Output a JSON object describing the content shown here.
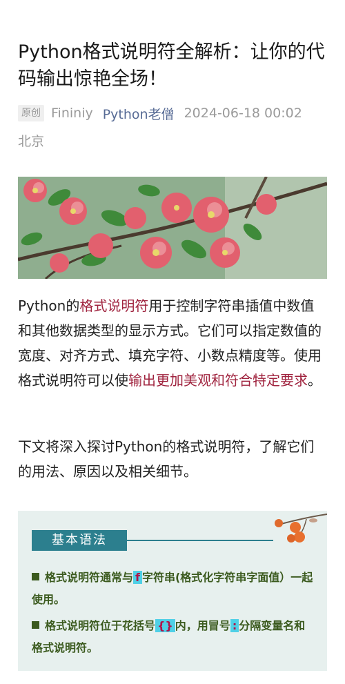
{
  "article": {
    "title": "Python格式说明符全解析：让你的代码输出惊艳全场！",
    "badge": "原创",
    "author": "Fininiy",
    "account": "Python老僧",
    "date": "2024-06-18 00:02",
    "location": "北京"
  },
  "hero_image": {
    "subject": "pink quince blossoms on a branch"
  },
  "paragraph1": {
    "a": "Python的",
    "b": "格式说明符",
    "c": "用于控制字符串插值中数值和其他数据类型的显示方式。它们可以指定数值的宽度、对齐方式、填充字符、小数点精度等。使用格式说明符可以使",
    "d": "输出更加美观和符合特定要求",
    "e": "。"
  },
  "paragraph2": "下文将深入探讨Python的格式说明符，了解它们的用法、原因以及相关细节。",
  "card": {
    "tag": "基本语法",
    "item1": {
      "a": "格式说明符通常与",
      "code": "f",
      "b": "字符串(格式化字符串字面值）一起使用。"
    },
    "item2": {
      "a": "格式说明符位于花括号",
      "code": "{}",
      "b": "内，用冒号",
      "code2": ":",
      "c": "分隔变量名和格式说明符。"
    }
  },
  "colors": {
    "highlight": "#a0243f",
    "account_link": "#576b95",
    "card_bg": "#e7f0ee",
    "card_tag": "#2c7f8e",
    "card_text": "#3b5a1e",
    "code_bg": "#4fd0e6"
  }
}
